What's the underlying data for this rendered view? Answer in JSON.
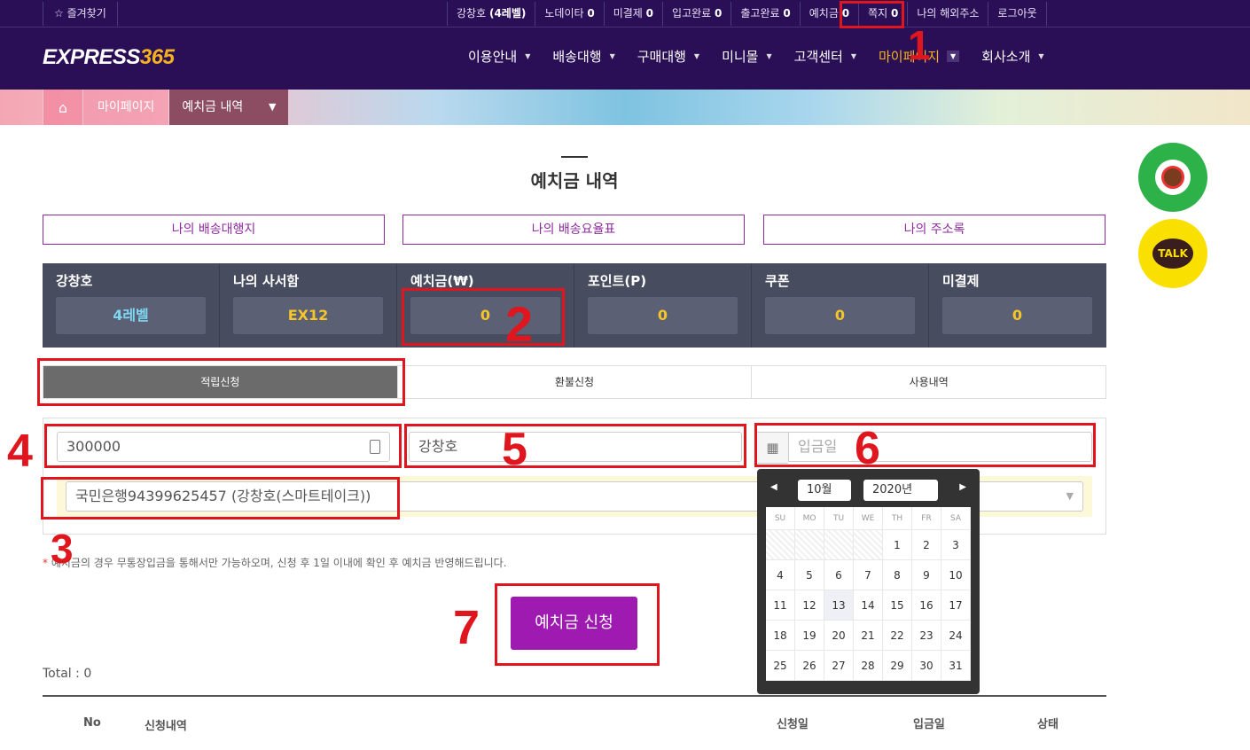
{
  "topbar": {
    "favorites": "☆ 즐겨찾기",
    "links": [
      {
        "label": "강창호",
        "value": "(4레벨)"
      },
      {
        "label": "노데이타",
        "value": "0"
      },
      {
        "label": "미결제",
        "value": "0"
      },
      {
        "label": "입고완료",
        "value": "0"
      },
      {
        "label": "출고완료",
        "value": "0"
      },
      {
        "label": "예치금",
        "value": "0"
      },
      {
        "label": "쪽지",
        "value": "0"
      },
      {
        "label": "나의 해외주소",
        "value": ""
      },
      {
        "label": "로그아웃",
        "value": ""
      }
    ]
  },
  "header": {
    "logo_main": "EXPRESS",
    "logo_num": "365",
    "nav": [
      "이용안내",
      "배송대행",
      "구매대행",
      "미니몰",
      "고객센터",
      "마이페이지",
      "회사소개"
    ],
    "active_nav": "마이페이지"
  },
  "breadcrumb": {
    "home_icon": "home-icon",
    "level1": "마이페이지",
    "level2": "예치금 내역"
  },
  "page": {
    "title": "예치금 내역",
    "quick_buttons": [
      "나의 배송대행지",
      "나의 배송요율표",
      "나의 주소록"
    ]
  },
  "summary": [
    {
      "label": "강창호",
      "value": "4레벨"
    },
    {
      "label": "나의 사서함",
      "value": "EX12"
    },
    {
      "label": "예치금(₩)",
      "value": "0"
    },
    {
      "label": "포인트(P)",
      "value": "0"
    },
    {
      "label": "쿠폰",
      "value": "0"
    },
    {
      "label": "미결제",
      "value": "0"
    }
  ],
  "tabs": [
    "적립신청",
    "환불신청",
    "사용내역"
  ],
  "form": {
    "amount_value": "300000",
    "depositor_value": "강창호",
    "date_placeholder": "입금일",
    "bank_value": "국민은행94399625457 (강창호(스마트테이크))",
    "notice": "예치금의 경우 무통장입금을 통해서만 가능하오며, 신청 후 1일 이내에 확인 후 예치금 반영해드립니다.",
    "notice_star": "*",
    "submit_label": "예치금 신청"
  },
  "list": {
    "total": "Total : 0",
    "headers": [
      "No",
      "신청내역",
      "신청일",
      "입금일",
      "상태"
    ]
  },
  "datepicker": {
    "month": "10월",
    "year": "2020년",
    "weekdays": [
      "SU",
      "MO",
      "TU",
      "WE",
      "TH",
      "FR",
      "SA"
    ],
    "weeks": [
      [
        "",
        "",
        "",
        "",
        "1",
        "2",
        "3"
      ],
      [
        "4",
        "5",
        "6",
        "7",
        "8",
        "9",
        "10"
      ],
      [
        "11",
        "12",
        "13",
        "14",
        "15",
        "16",
        "17"
      ],
      [
        "18",
        "19",
        "20",
        "21",
        "22",
        "23",
        "24"
      ],
      [
        "25",
        "26",
        "27",
        "28",
        "29",
        "30",
        "31"
      ]
    ],
    "today": "13"
  },
  "side": {
    "talk_label": "TALK"
  },
  "annotations": [
    "1",
    "2",
    "3",
    "4",
    "5",
    "6",
    "7"
  ],
  "colors": {
    "brand": "#2a0f57",
    "accent": "#9e1ab0",
    "highlight": "#f5b21e",
    "annotation": "#e0161e"
  }
}
